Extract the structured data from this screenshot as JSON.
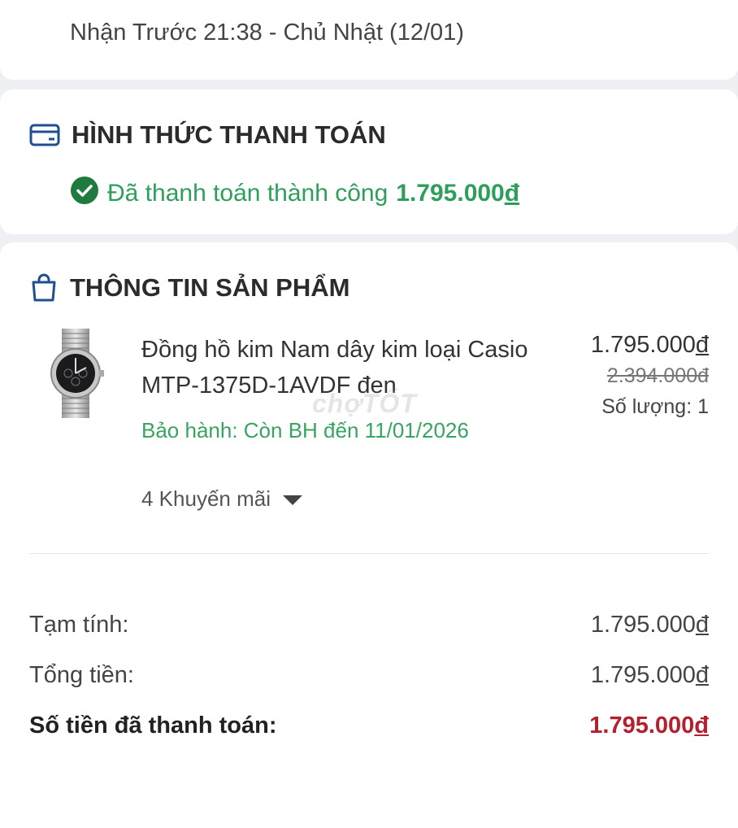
{
  "delivery": {
    "text": "Nhận Trước 21:38 - Chủ Nhật (12/01)"
  },
  "payment": {
    "title": "HÌNH THỨC THANH TOÁN",
    "status_text": "Đã thanh toán thành công",
    "amount_number": "1.795.000",
    "currency": "đ",
    "icon": "credit-card-icon",
    "status_icon": "check-circle-icon",
    "accent_color": "#2e9f5a"
  },
  "product": {
    "title": "THÔNG TIN SẢN PHẨM",
    "icon": "shopping-bag-icon",
    "name": "Đồng hồ kim Nam dây kim loại Casio MTP-1375D-1AVDF đen",
    "price_number": "1.795.000",
    "old_price": "2.394.000đ",
    "currency": "đ",
    "quantity": "Số lượng: 1",
    "warranty": "Bảo hành: Còn BH đến 11/01/2026",
    "promotions": "4 Khuyến mãi",
    "watermark": "chợTỐT"
  },
  "summary": {
    "subtotal_label": "Tạm tính:",
    "subtotal_number": "1.795.000",
    "total_label": "Tổng tiền:",
    "total_number": "1.795.000",
    "paid_label": "Số tiền đã thanh toán:",
    "paid_number": "1.795.000",
    "currency": "đ",
    "paid_color": "#b3202f"
  }
}
